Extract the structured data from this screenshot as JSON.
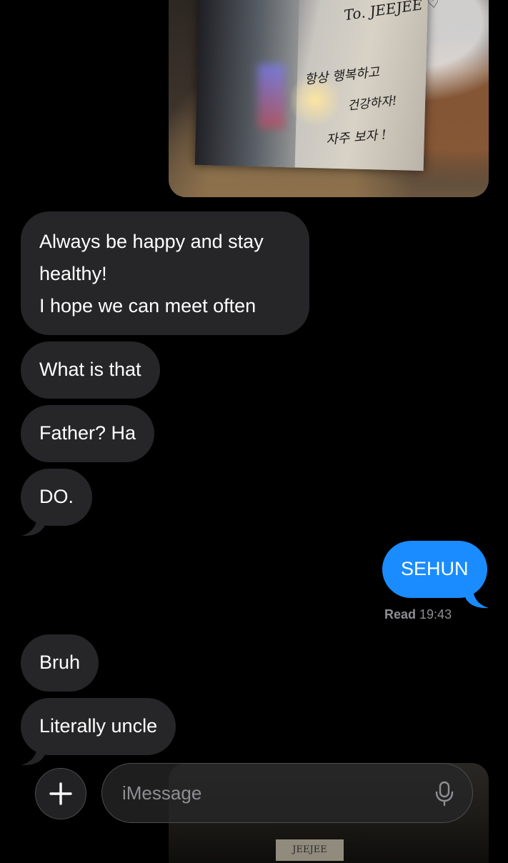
{
  "messages": {
    "m1": {
      "lines": [
        "Always be happy and stay",
        "healthy!",
        "I hope we can meet often"
      ]
    },
    "m2": "What is that",
    "m3": "Father? Ha",
    "m4": "DO.",
    "m5": "SEHUN",
    "m6": "Bruh",
    "m7": "Literally uncle"
  },
  "receipt": {
    "label": "Read",
    "time": "19:43"
  },
  "photo": {
    "handwriting_a": "To. JEEJEE ♡",
    "handwriting_b": "항상 행복하고",
    "handwriting_c": "건강하자!",
    "handwriting_d": "자주 보자 !",
    "composer_label": "JEEJEE"
  },
  "composer": {
    "placeholder": "iMessage"
  },
  "icons": {
    "plus": "plus-icon",
    "mic": "microphone-icon"
  },
  "colors": {
    "incoming": "#262628",
    "outgoing": "#1a8cff",
    "background": "#000000"
  }
}
